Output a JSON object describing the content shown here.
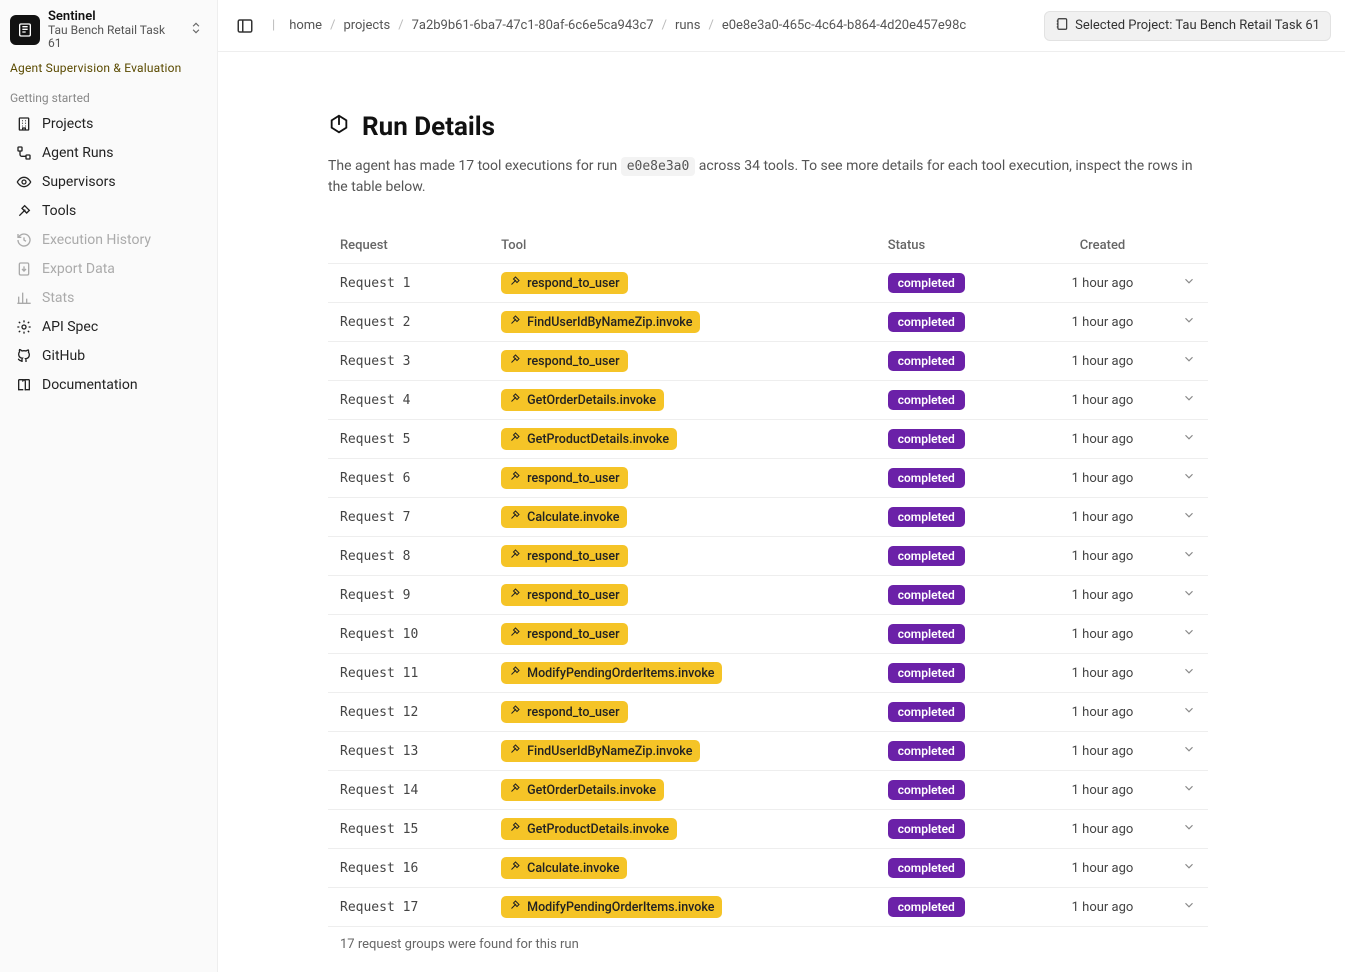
{
  "app": {
    "name": "Sentinel",
    "subtitle": "Tau Bench Retail Task 61",
    "tagline": "Agent Supervision & Evaluation"
  },
  "sidebar": {
    "section_label": "Getting started",
    "items": [
      {
        "label": "Projects",
        "icon": "building-icon",
        "disabled": false
      },
      {
        "label": "Agent Runs",
        "icon": "workflow-icon",
        "disabled": false
      },
      {
        "label": "Supervisors",
        "icon": "eye-cog-icon",
        "disabled": false
      },
      {
        "label": "Tools",
        "icon": "axe-icon",
        "disabled": false
      },
      {
        "label": "Execution History",
        "icon": "history-icon",
        "disabled": true
      },
      {
        "label": "Export Data",
        "icon": "export-icon",
        "disabled": true
      },
      {
        "label": "Stats",
        "icon": "stats-icon",
        "disabled": true
      },
      {
        "label": "API Spec",
        "icon": "api-icon",
        "disabled": false
      },
      {
        "label": "GitHub",
        "icon": "github-icon",
        "disabled": false
      },
      {
        "label": "Documentation",
        "icon": "book-icon",
        "disabled": false
      }
    ]
  },
  "topbar": {
    "breadcrumbs": [
      "home",
      "projects",
      "7a2b9b61-6ba7-47c1-80af-6c6e5ca943c7",
      "runs",
      "e0e8e3a0-465c-4c64-b864-4d20e457e98c"
    ],
    "project_badge": "Selected Project: Tau Bench Retail Task 61"
  },
  "page": {
    "title": "Run Details",
    "desc_prefix": "The agent has made 17 tool executions for run ",
    "desc_code": "e0e8e3a0",
    "desc_suffix": " across 34 tools. To see more details for each tool execution, inspect the rows in the table below."
  },
  "table": {
    "headers": {
      "request": "Request",
      "tool": "Tool",
      "status": "Status",
      "created": "Created"
    },
    "footer": "17 request groups were found for this run",
    "rows": [
      {
        "request": "Request 1",
        "tool": "respond_to_user",
        "status": "completed",
        "created": "1 hour ago"
      },
      {
        "request": "Request 2",
        "tool": "FindUserIdByNameZip.invoke",
        "status": "completed",
        "created": "1 hour ago"
      },
      {
        "request": "Request 3",
        "tool": "respond_to_user",
        "status": "completed",
        "created": "1 hour ago"
      },
      {
        "request": "Request 4",
        "tool": "GetOrderDetails.invoke",
        "status": "completed",
        "created": "1 hour ago"
      },
      {
        "request": "Request 5",
        "tool": "GetProductDetails.invoke",
        "status": "completed",
        "created": "1 hour ago"
      },
      {
        "request": "Request 6",
        "tool": "respond_to_user",
        "status": "completed",
        "created": "1 hour ago"
      },
      {
        "request": "Request 7",
        "tool": "Calculate.invoke",
        "status": "completed",
        "created": "1 hour ago"
      },
      {
        "request": "Request 8",
        "tool": "respond_to_user",
        "status": "completed",
        "created": "1 hour ago"
      },
      {
        "request": "Request 9",
        "tool": "respond_to_user",
        "status": "completed",
        "created": "1 hour ago"
      },
      {
        "request": "Request 10",
        "tool": "respond_to_user",
        "status": "completed",
        "created": "1 hour ago"
      },
      {
        "request": "Request 11",
        "tool": "ModifyPendingOrderItems.invoke",
        "status": "completed",
        "created": "1 hour ago"
      },
      {
        "request": "Request 12",
        "tool": "respond_to_user",
        "status": "completed",
        "created": "1 hour ago"
      },
      {
        "request": "Request 13",
        "tool": "FindUserIdByNameZip.invoke",
        "status": "completed",
        "created": "1 hour ago"
      },
      {
        "request": "Request 14",
        "tool": "GetOrderDetails.invoke",
        "status": "completed",
        "created": "1 hour ago"
      },
      {
        "request": "Request 15",
        "tool": "GetProductDetails.invoke",
        "status": "completed",
        "created": "1 hour ago"
      },
      {
        "request": "Request 16",
        "tool": "Calculate.invoke",
        "status": "completed",
        "created": "1 hour ago"
      },
      {
        "request": "Request 17",
        "tool": "ModifyPendingOrderItems.invoke",
        "status": "completed",
        "created": "1 hour ago"
      }
    ]
  }
}
